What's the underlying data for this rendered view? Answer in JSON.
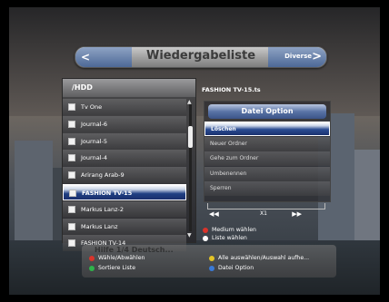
{
  "header": {
    "title": "Wiedergabeliste",
    "right_label": "Diverse",
    "left_arrow": "<",
    "right_arrow": ">"
  },
  "file_panel": {
    "path": "/HDD",
    "items": [
      {
        "label": "Tv One"
      },
      {
        "label": "Journal-6"
      },
      {
        "label": "Journal-5"
      },
      {
        "label": "Journal-4"
      },
      {
        "label": "Arirang Arab-9"
      },
      {
        "label": "FASHION TV-15"
      },
      {
        "label": "Markus Lanz-2"
      },
      {
        "label": "Markus Lanz"
      },
      {
        "label": "FASHION TV-14"
      }
    ],
    "selected_index": 5,
    "scroll_up": "▲",
    "scroll_down": "▼"
  },
  "details": {
    "file_title": "FASHION TV-15.ts"
  },
  "options": {
    "header": "Datei Option",
    "items": [
      "Löschen",
      "Neuer Ordner",
      "Gehe zum Ordner",
      "Umbenennen",
      "Sperren"
    ],
    "selected_index": 0
  },
  "speed": {
    "rewind": "◀◀",
    "multiplier": "X1",
    "forward": "▶▶"
  },
  "media_options": {
    "medium": "Medium wählen",
    "list": "Liste wählen"
  },
  "bottom": {
    "ticker": "Hilfe  1/4  Deutsch...",
    "legend": [
      {
        "color": "#d9342b",
        "label": "Wähle/Abwählen"
      },
      {
        "color": "#2fb34a",
        "label": "Sortiere Liste"
      },
      {
        "color": "#e3c326",
        "label": "Alle auswählen/Auswahl aufhe..."
      },
      {
        "color": "#3a7ad6",
        "label": "Datei Option"
      }
    ]
  },
  "colors": {
    "accent": "#2a4c92",
    "header_grey": "#9e9e9e",
    "white_dot": "#ffffff"
  }
}
